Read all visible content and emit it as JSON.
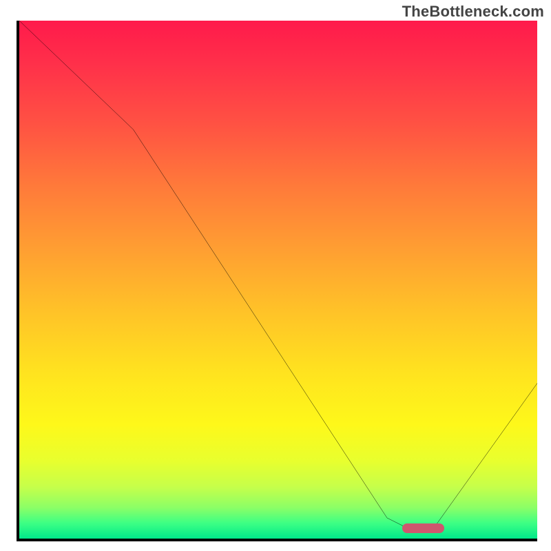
{
  "attribution": "TheBottleneck.com",
  "colors": {
    "axis": "#000000",
    "curve": "#000000",
    "marker": "#ce576e",
    "gradient_top": "#ff1a4b",
    "gradient_bottom": "#00e88a"
  },
  "chart_data": {
    "type": "line",
    "title": "",
    "xlabel": "",
    "ylabel": "",
    "xlim": [
      0,
      100
    ],
    "ylim": [
      0,
      100
    ],
    "x": [
      0,
      22,
      71,
      75,
      80,
      100
    ],
    "values": [
      100,
      79,
      4,
      2,
      2,
      30
    ],
    "marker": {
      "x_start": 74,
      "x_end": 82,
      "y": 2
    },
    "annotations": []
  }
}
